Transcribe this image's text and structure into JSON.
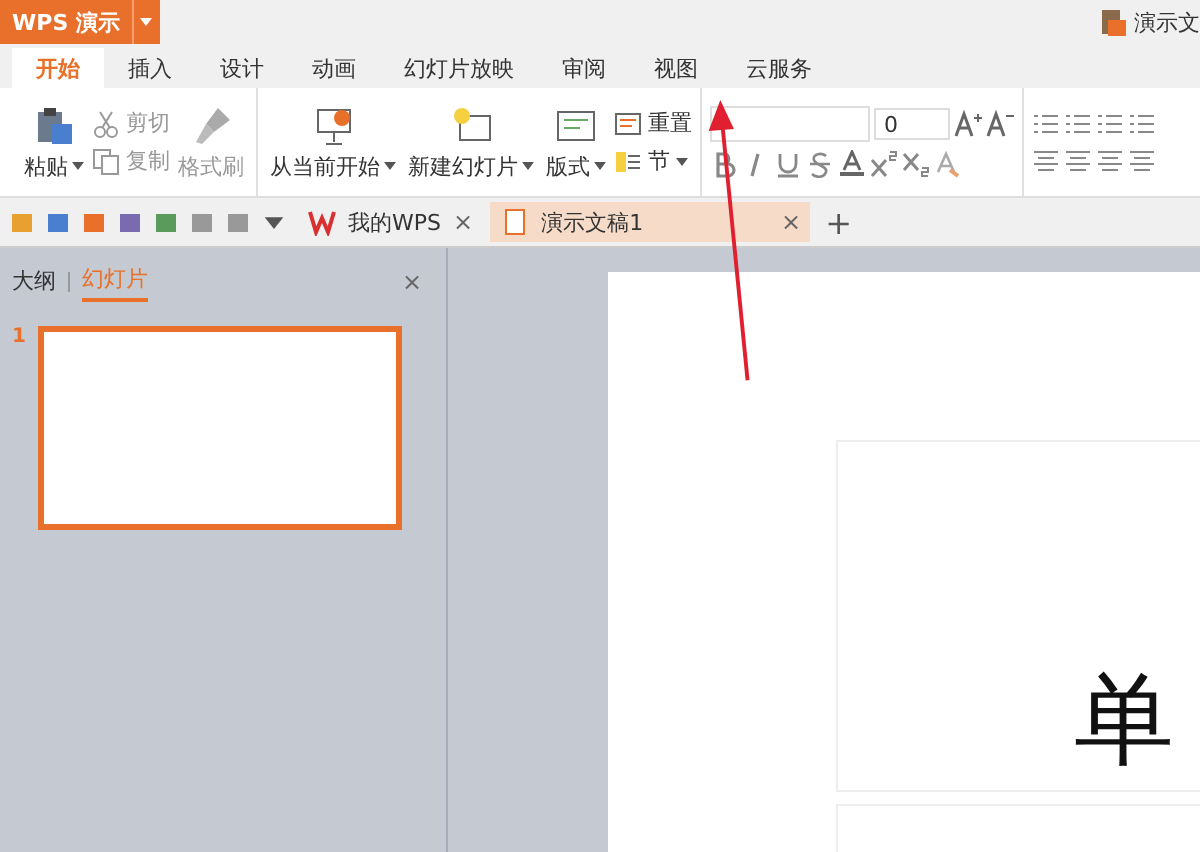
{
  "app_menu": {
    "label": "WPS 演示"
  },
  "document_title": "演示文",
  "tabs": [
    {
      "label": "开始",
      "selected": true
    },
    {
      "label": "插入",
      "selected": false
    },
    {
      "label": "设计",
      "selected": false
    },
    {
      "label": "动画",
      "selected": false
    },
    {
      "label": "幻灯片放映",
      "selected": false
    },
    {
      "label": "审阅",
      "selected": false
    },
    {
      "label": "视图",
      "selected": false
    },
    {
      "label": "云服务",
      "selected": false
    }
  ],
  "clipboard": {
    "paste": "粘贴",
    "small": [
      {
        "label": "剪切",
        "disabled": true
      },
      {
        "label": "复制",
        "disabled": true
      }
    ],
    "format_painter": {
      "label": "格式刷",
      "disabled": true
    }
  },
  "slides_group": {
    "from_current": "从当前开始",
    "new_slide": "新建幻灯片",
    "layout": "版式",
    "reset": "重置",
    "section": "节"
  },
  "font": {
    "size": "0"
  },
  "doc_tabs": [
    {
      "label": "我的WPS",
      "selected": false,
      "close": "×"
    },
    {
      "label": "演示文稿1",
      "selected": true,
      "close": "×"
    }
  ],
  "new_tab": "+",
  "panel": {
    "close": "×",
    "tabs": [
      {
        "label": "大纲",
        "selected": false
      },
      {
        "label": "幻灯片",
        "selected": true
      }
    ],
    "slides": [
      {
        "number": "1",
        "selected": true
      }
    ]
  },
  "slide": {
    "title_text": "单"
  }
}
